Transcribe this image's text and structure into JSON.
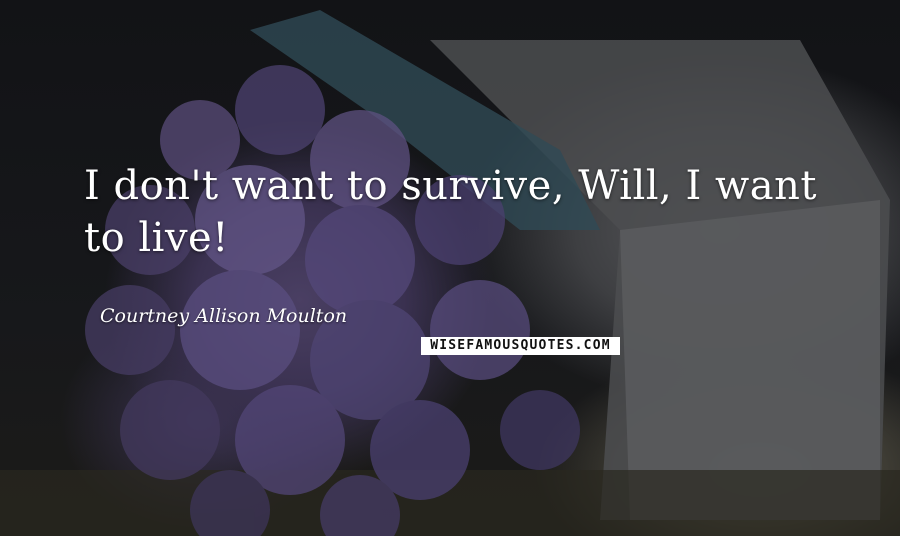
{
  "quote": {
    "text": "I don't want to survive, Will, I want to live!",
    "author": "Courtney Allison Moulton"
  },
  "watermark": {
    "text": "WISEFAMOUSQUOTES.COM"
  },
  "colors": {
    "text": "#ffffff",
    "flowers": "#4a3f63",
    "box": "#58595c",
    "background": "#0d0e10"
  }
}
